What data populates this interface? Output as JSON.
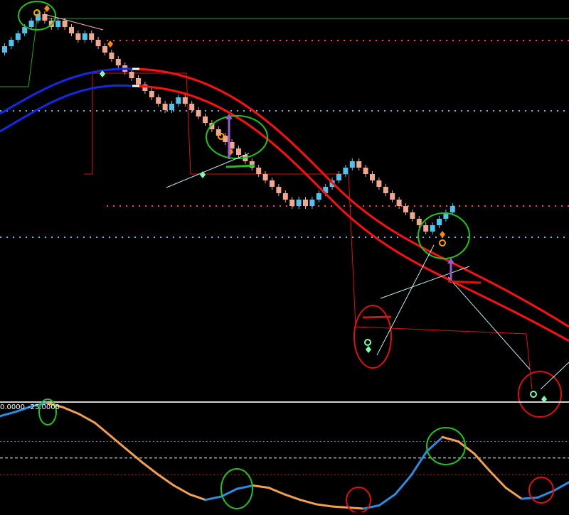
{
  "chart_data": [
    {
      "type": "candlestick",
      "panel": "price",
      "bars": [
        [
          "up",
          83.0,
          92.0
        ],
        [
          "up",
          92.0,
          101.0
        ],
        [
          "up",
          101.0,
          110.0
        ],
        [
          "up",
          110.0,
          119.0
        ],
        [
          "up",
          119.0,
          128.0
        ],
        [
          "up",
          128.0,
          137.0
        ],
        [
          "down",
          137.0,
          128.0
        ],
        [
          "down",
          128.0,
          119.0
        ],
        [
          "up",
          119.0,
          128.0
        ],
        [
          "down",
          128.0,
          119.0
        ],
        [
          "down",
          119.0,
          110.0
        ],
        [
          "down",
          110.0,
          101.0
        ],
        [
          "up",
          101.0,
          110.0
        ],
        [
          "down",
          110.0,
          101.0
        ],
        [
          "down",
          101.0,
          92.0
        ],
        [
          "down",
          92.0,
          83.0
        ],
        [
          "down",
          83.0,
          74.0
        ],
        [
          "down",
          74.0,
          65.0
        ],
        [
          "down",
          65.0,
          56.0
        ],
        [
          "down",
          56.0,
          47.0
        ],
        [
          "down",
          47.0,
          38.0
        ],
        [
          "down",
          38.0,
          29.0
        ],
        [
          "down",
          29.0,
          20.0
        ],
        [
          "down",
          20.0,
          11.0
        ],
        [
          "down",
          11.0,
          2.0
        ],
        [
          "up",
          2.0,
          11.0
        ],
        [
          "up",
          11.0,
          20.0
        ],
        [
          "down",
          20.0,
          11.0
        ],
        [
          "down",
          11.0,
          2.0
        ],
        [
          "down",
          2.0,
          -7.0
        ],
        [
          "down",
          -7.0,
          -16.0
        ],
        [
          "down",
          -16.0,
          -25.0
        ],
        [
          "down",
          -25.0,
          -34.0
        ],
        [
          "down",
          -34.0,
          -43.0
        ],
        [
          "down",
          -43.0,
          -52.0
        ],
        [
          "down",
          -52.0,
          -61.0
        ],
        [
          "down",
          -61.0,
          -70.0
        ],
        [
          "down",
          -70.0,
          -79.0
        ],
        [
          "down",
          -79.0,
          -88.0
        ],
        [
          "down",
          -88.0,
          -97.0
        ],
        [
          "down",
          -97.0,
          -106.0
        ],
        [
          "down",
          -106.0,
          -115.0
        ],
        [
          "down",
          -115.0,
          -124.0
        ],
        [
          "down",
          -124.0,
          -133.0
        ],
        [
          "up",
          -133.0,
          -124.0
        ],
        [
          "down",
          -124.0,
          -133.0
        ],
        [
          "up",
          -133.0,
          -124.0
        ],
        [
          "up",
          -124.0,
          -115.0
        ],
        [
          "up",
          -115.0,
          -106.0
        ],
        [
          "up",
          -106.0,
          -97.0
        ],
        [
          "up",
          -97.0,
          -88.0
        ],
        [
          "up",
          -88.0,
          -79.0
        ],
        [
          "up",
          -79.0,
          -70.0
        ],
        [
          "down",
          -70.0,
          -79.0
        ],
        [
          "down",
          -79.0,
          -88.0
        ],
        [
          "down",
          -88.0,
          -97.0
        ],
        [
          "down",
          -97.0,
          -106.0
        ],
        [
          "down",
          -106.0,
          -115.0
        ],
        [
          "down",
          -115.0,
          -124.0
        ],
        [
          "down",
          -124.0,
          -133.0
        ],
        [
          "down",
          -133.0,
          -142.0
        ],
        [
          "down",
          -142.0,
          -151.0
        ],
        [
          "down",
          -151.0,
          -160.0
        ],
        [
          "down",
          -160.0,
          -169.0
        ],
        [
          "up",
          -169.0,
          -160.0
        ],
        [
          "up",
          -160.0,
          -151.0
        ],
        [
          "up",
          -151.0,
          -142.0
        ],
        [
          "up",
          -142.0,
          -133.0
        ]
      ],
      "colors": {
        "up": "#4fc3ee",
        "down": "#f0a890",
        "ma_fast": "#ff1010",
        "ma_slow": "#1428e6",
        "bg": "#000000"
      },
      "ma_fast": [
        [
          0,
          null
        ],
        [
          12,
          125
        ],
        [
          18,
          125
        ],
        [
          30,
          102
        ],
        [
          40,
          72
        ],
        [
          46,
          54
        ],
        [
          52,
          48
        ],
        [
          56,
          40
        ],
        [
          60,
          26
        ],
        [
          68,
          10
        ]
      ],
      "ma_slow": [
        [
          0,
          70
        ],
        [
          12,
          106
        ],
        [
          18,
          112
        ]
      ],
      "levels": [
        {
          "y": 100,
          "color": "#ff4444",
          "style": "dotted"
        },
        {
          "y": 1,
          "color": "#4fc3ee",
          "style": "dotted"
        },
        {
          "y": -133,
          "color": "#ff4444",
          "style": "dotted"
        },
        {
          "y": -177,
          "color": "#4fc3ee",
          "style": "dotted"
        }
      ]
    },
    {
      "type": "line",
      "panel": "oscillator",
      "header": [
        "0.0000",
        "-25.0000"
      ],
      "levels": [
        {
          "y": -25,
          "color": "#ffffff"
        },
        {
          "y": -55,
          "color": "#22aa22",
          "style": "dotted"
        },
        {
          "y": -70,
          "color": "#ffffff",
          "style": "dashed"
        },
        {
          "y": -85,
          "color": "#cc2222",
          "style": "dotted"
        }
      ],
      "series": [
        {
          "color_up": "#2b8de0",
          "color_down": "#f0a050",
          "values": [
            -32,
            -28,
            -23,
            -20,
            -24,
            -30,
            -38,
            -50,
            -62,
            -74,
            -85,
            -95,
            -103,
            -108,
            -105,
            -98,
            -95,
            -97,
            -103,
            -108,
            -112,
            -114,
            -115,
            -116,
            -113,
            -103,
            -86,
            -64,
            -51,
            -55,
            -66,
            -82,
            -97,
            -107,
            -106,
            -100,
            -92
          ]
        }
      ]
    }
  ]
}
